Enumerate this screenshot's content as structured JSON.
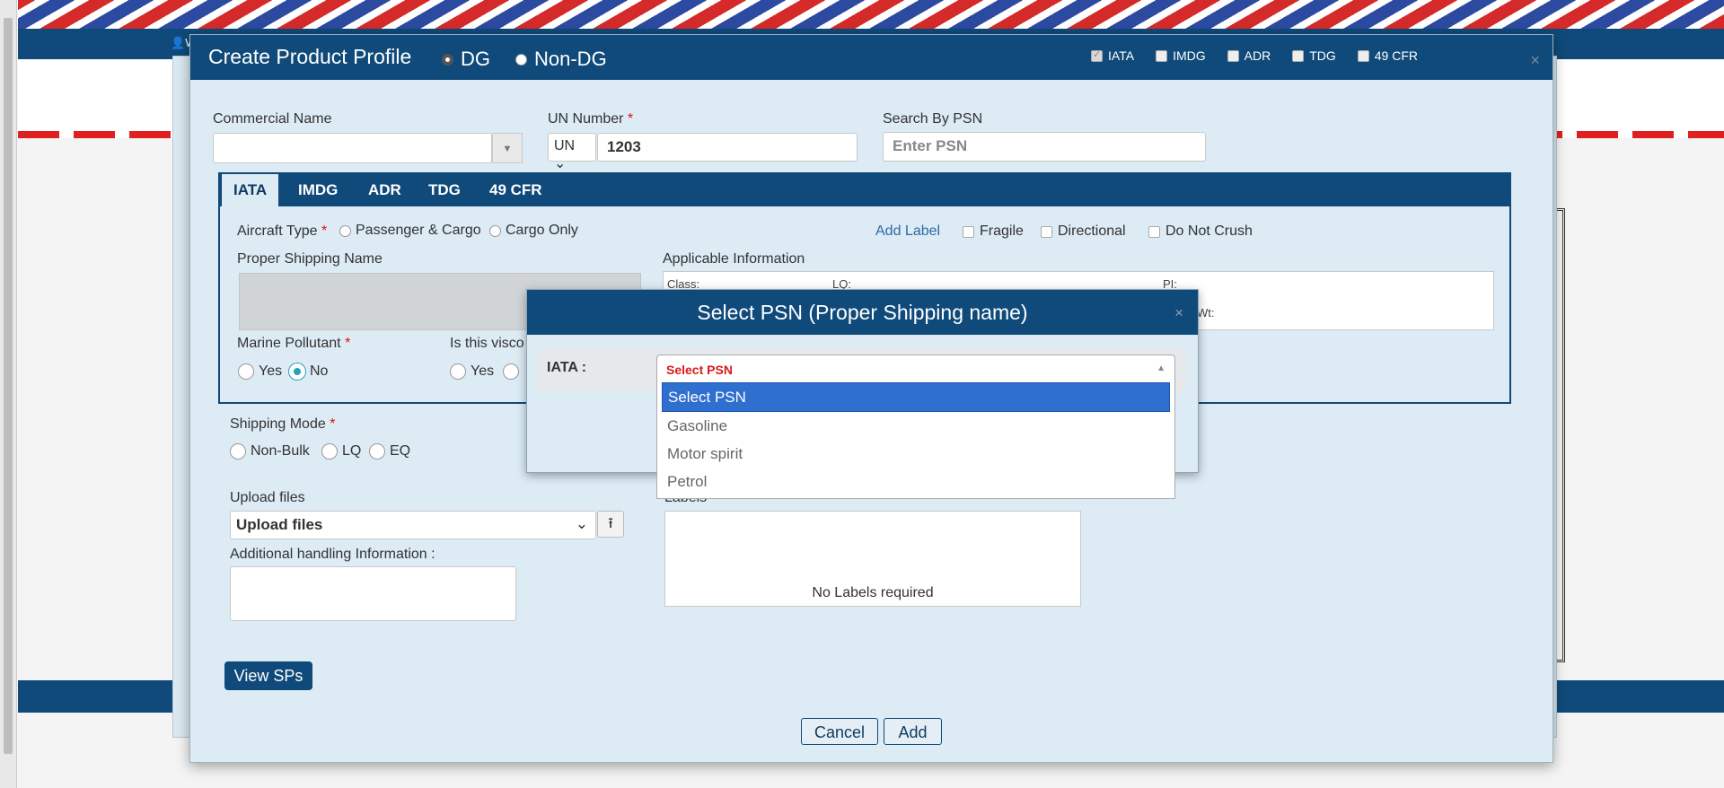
{
  "background": {
    "user_initial": "W"
  },
  "modal": {
    "title": "Create Product Profile",
    "dg_label": "DG",
    "non_dg_label": "Non-DG",
    "regulations": [
      {
        "label": "IATA",
        "checked": true
      },
      {
        "label": "IMDG",
        "checked": false
      },
      {
        "label": "ADR",
        "checked": false
      },
      {
        "label": "TDG",
        "checked": false
      },
      {
        "label": "49 CFR",
        "checked": false
      }
    ],
    "close_symbol": "×",
    "commercial_name_label": "Commercial Name",
    "commercial_name_value": "",
    "un_number_label": "UN Number",
    "required_mark": "*",
    "un_prefix": "UN",
    "un_value": "1203",
    "search_psn_label": "Search By PSN",
    "search_psn_placeholder": "Enter PSN",
    "tabs": [
      "IATA",
      "IMDG",
      "ADR",
      "TDG",
      "49 CFR"
    ],
    "aircraft_type_label": "Aircraft Type",
    "aircraft_passenger": "Passenger & Cargo",
    "aircraft_cargo": "Cargo Only",
    "add_label": "Add Label",
    "fragile": "Fragile",
    "directional": "Directional",
    "do_not_crush": "Do Not Crush",
    "psn_label": "Proper Shipping Name",
    "applicable_info_label": "Applicable Information",
    "class_label": "Class:",
    "lq_label": "LQ:",
    "pi_label": "PI:",
    "wt_label": "Wt:",
    "marine_pollutant_label": "Marine Pollutant",
    "yes": "Yes",
    "no": "No",
    "viscous_label": "Is this visco",
    "shipping_mode_label": "Shipping Mode",
    "shipping_modes": [
      "Non-Bulk",
      "LQ",
      "EQ"
    ],
    "upload_files_label": "Upload files",
    "upload_select_value": "Upload files",
    "additional_info_label": "Additional handling Information :",
    "labels_heading": "Labels",
    "no_labels_text": "No Labels required",
    "view_sps": "View SPs",
    "cancel": "Cancel",
    "add": "Add"
  },
  "psn_dialog": {
    "title": "Select PSN (Proper Shipping name)",
    "close_symbol": "×",
    "iata_label": "IATA :",
    "selected_value": "Select PSN",
    "options": [
      "Select PSN",
      "Gasoline",
      "Motor spirit",
      "Petrol"
    ]
  }
}
